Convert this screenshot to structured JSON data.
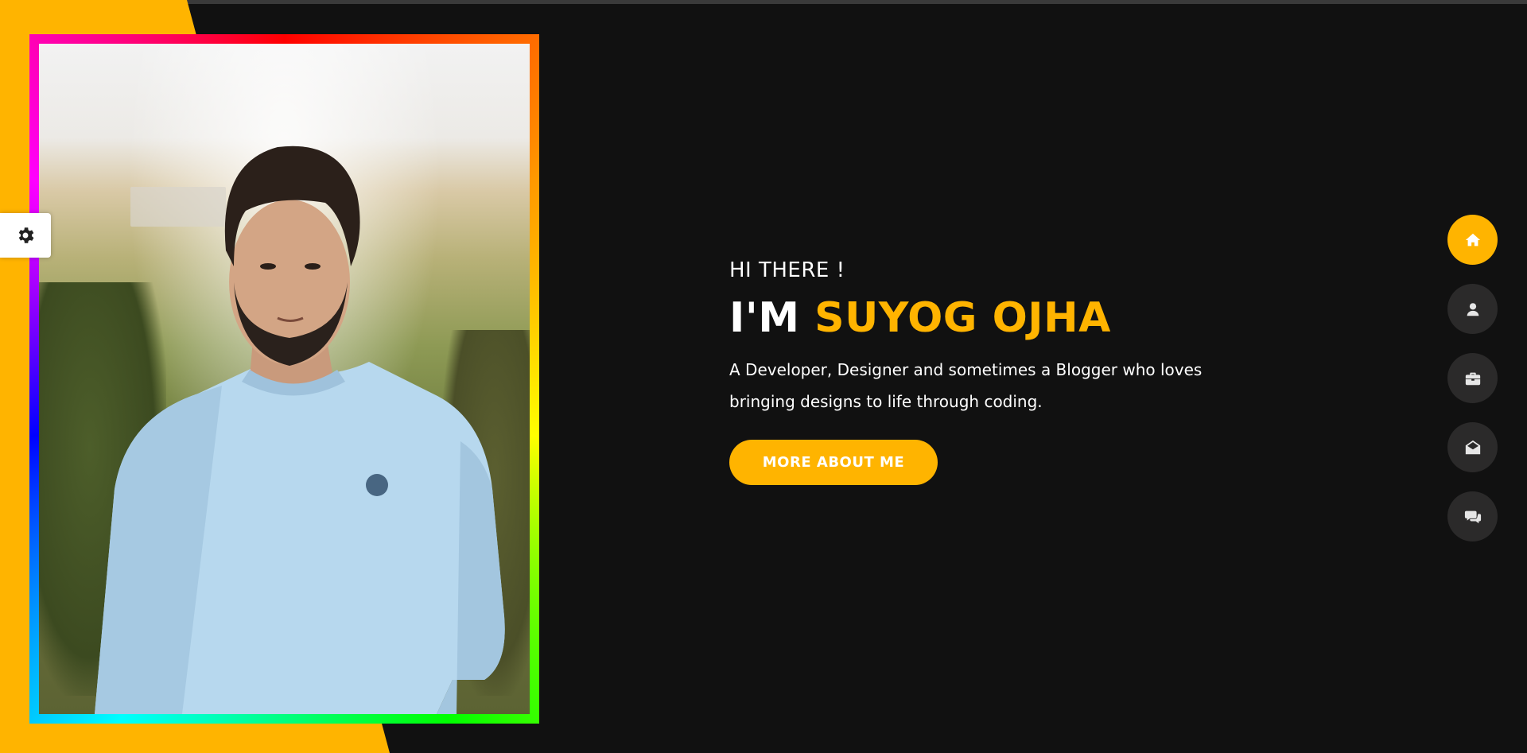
{
  "colors": {
    "accent": "#ffb400",
    "background": "#111111",
    "nav_inactive": "#2b2a2a",
    "text": "#ffffff"
  },
  "settings": {
    "icon": "gear-icon"
  },
  "hero": {
    "greeting": "HI THERE !",
    "name_prefix": "I'M ",
    "name": "SUYOG OJHA",
    "tagline": "A Developer, Designer and sometimes a Blogger who loves bringing designs to life through coding.",
    "cta_label": "MORE ABOUT ME"
  },
  "nav": {
    "items": [
      {
        "icon": "home-icon",
        "active": true
      },
      {
        "icon": "user-icon",
        "active": false
      },
      {
        "icon": "briefcase-icon",
        "active": false
      },
      {
        "icon": "envelope-open-icon",
        "active": false
      },
      {
        "icon": "comments-icon",
        "active": false
      }
    ]
  }
}
